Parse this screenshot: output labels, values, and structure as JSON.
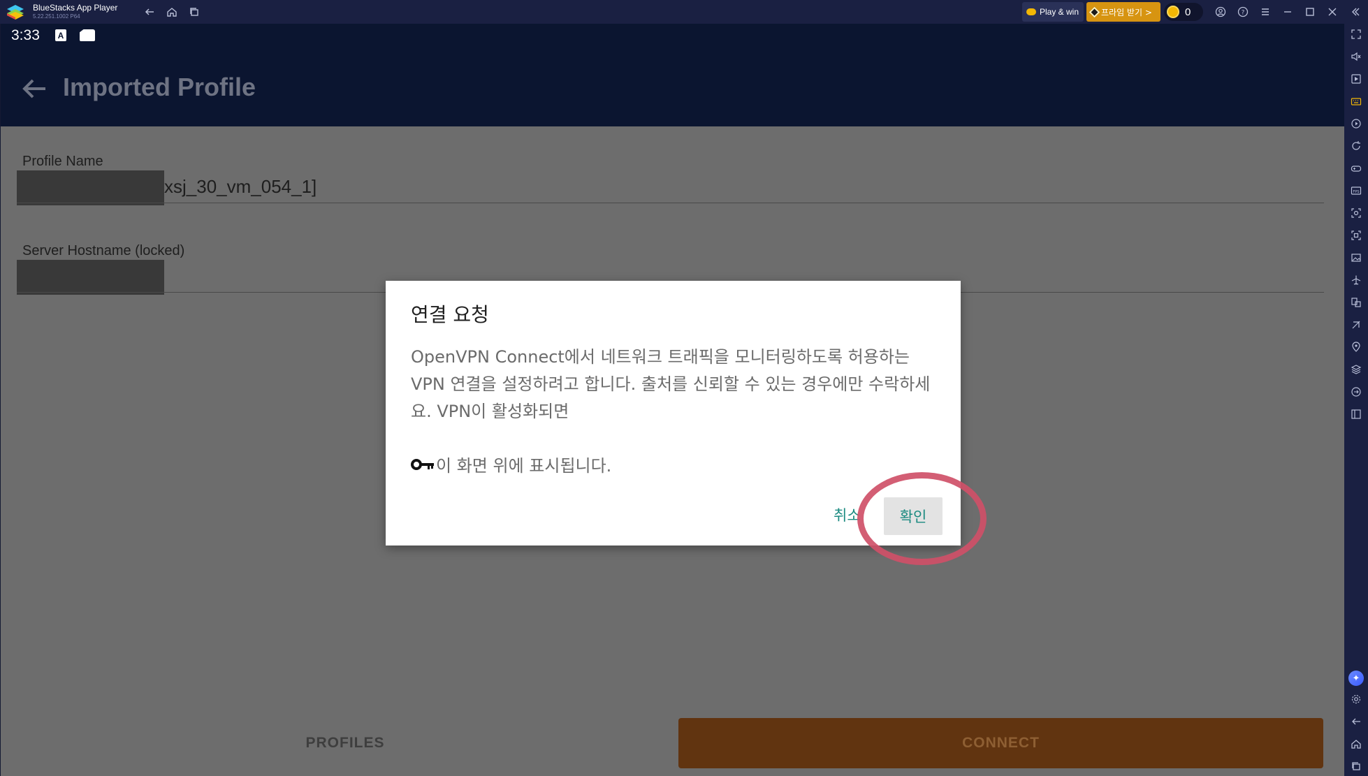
{
  "window": {
    "app_name": "BlueStacks App Player",
    "version": "5.22.251.1002  P64",
    "play_win": "Play & win",
    "promo": "프라임 받기 >",
    "coin_count": "0"
  },
  "android": {
    "status_time": "3:33",
    "status_icon_a": "A",
    "page_title": "Imported Profile",
    "fields": [
      {
        "label": "Profile Name",
        "value": "xsj_30_vm_054_1]"
      },
      {
        "label": "Server Hostname (locked)",
        "value": ""
      }
    ],
    "profiles_button": "PROFILES",
    "connect_button": "CONNECT"
  },
  "dialog": {
    "title": "연결 요청",
    "message": "OpenVPN Connect에서 네트워크 트래픽을 모니터링하도록 허용하는 VPN 연결을 설정하려고 합니다. 출처를 신뢰할 수 있는 경우에만 수락하세요. VPN이 활성화되면",
    "message2": "이 화면 위에 표시됩니다.",
    "cancel": "취소",
    "ok": "확인"
  },
  "colors": {
    "appbar": "#0b1530",
    "accent_teal": "#1b8a80",
    "connect_bg": "#613410",
    "highlight": "#cf5068"
  }
}
